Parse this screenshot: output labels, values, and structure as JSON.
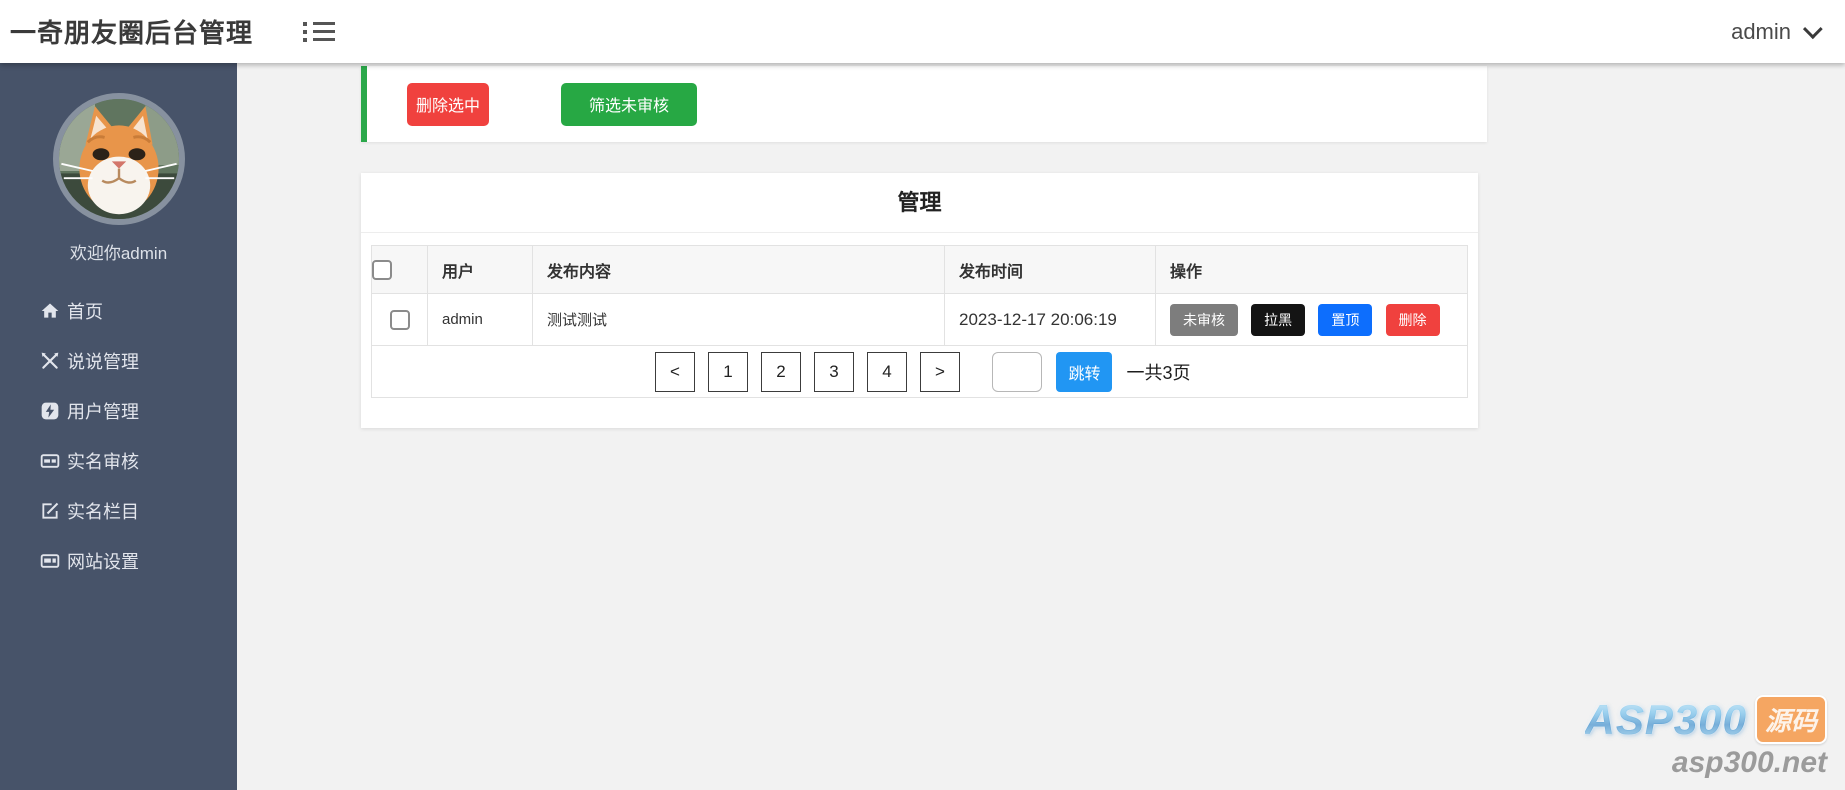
{
  "header": {
    "title": "一奇朋友圈后台管理",
    "user": "admin"
  },
  "sidebar": {
    "welcome": "欢迎你admin",
    "items": [
      {
        "label": "首页",
        "icon": "home-icon"
      },
      {
        "label": "说说管理",
        "icon": "edit-tools-icon"
      },
      {
        "label": "用户管理",
        "icon": "lightning-icon"
      },
      {
        "label": "实名审核",
        "icon": "id-card-icon"
      },
      {
        "label": "实名栏目",
        "icon": "edit-square-icon"
      },
      {
        "label": "网站设置",
        "icon": "browser-icon"
      }
    ]
  },
  "toolbar": {
    "delete_selected": "删除选中",
    "filter_unreviewed": "筛选未审核"
  },
  "panel": {
    "title": "管理",
    "table": {
      "headers": [
        "用户",
        "发布内容",
        "发布时间",
        "操作"
      ],
      "rows": [
        {
          "user": "admin",
          "content": "测试测试",
          "time": "2023-12-17 20:06:19",
          "actions": [
            "未审核",
            "拉黑",
            "置顶",
            "删除"
          ]
        }
      ]
    },
    "pagination": {
      "prev": "<",
      "pages": [
        "1",
        "2",
        "3",
        "4"
      ],
      "next": ">",
      "jump_value": "",
      "jump_label": "跳转",
      "total": "一共3页"
    }
  },
  "watermark": {
    "brand": "ASP300",
    "badge": "源码",
    "domain": "asp300.net"
  },
  "colors": {
    "sidebar_bg": "#475369",
    "accent_green": "#27a844",
    "accent_red": "#f0413e",
    "action_gray": "#7d7d7d",
    "action_black": "#141414",
    "action_blue": "#0d6efd",
    "jump_blue": "#2196f3",
    "watermark_orange": "#f5a662",
    "page_bg": "#f2f2f2"
  }
}
